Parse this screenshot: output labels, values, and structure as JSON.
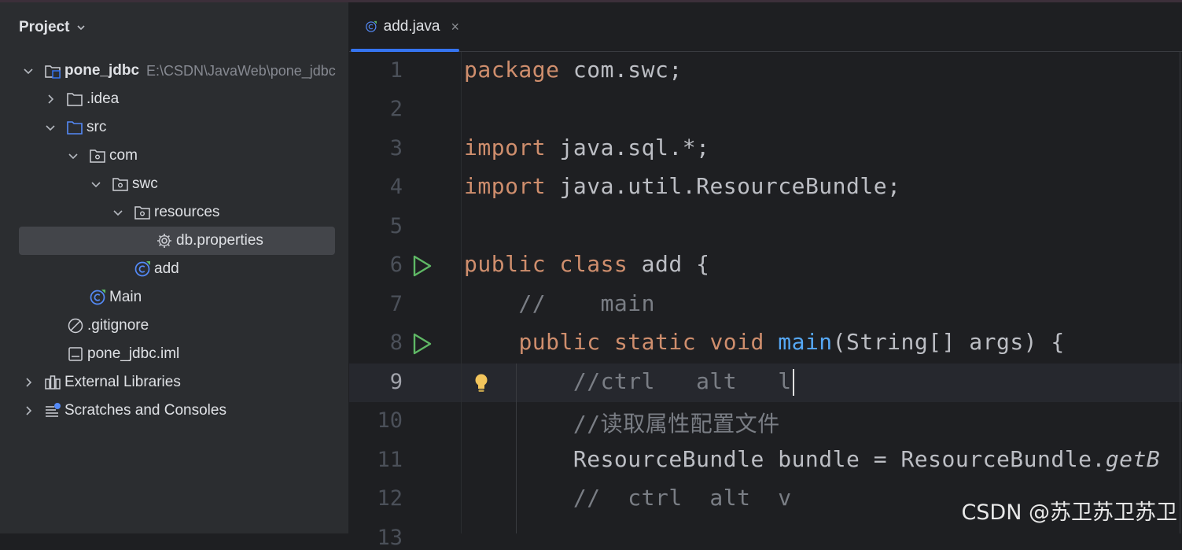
{
  "panel": {
    "title": "Project"
  },
  "tree": {
    "root": {
      "name": "pone_jdbc",
      "path": "E:\\CSDN\\JavaWeb\\pone_jdbc"
    },
    "idea": ".idea",
    "src": "src",
    "com": "com",
    "swc": "swc",
    "resources": "resources",
    "db_properties": "db.properties",
    "add": "add",
    "main": "Main",
    "gitignore": ".gitignore",
    "iml": "pone_jdbc.iml",
    "external_libraries": "External Libraries",
    "scratches": "Scratches and Consoles"
  },
  "editor": {
    "tab": {
      "label": "add.java",
      "close": "×"
    },
    "line_numbers": [
      "1",
      "2",
      "3",
      "4",
      "5",
      "6",
      "7",
      "8",
      "9",
      "10",
      "11",
      "12",
      "13"
    ],
    "current_line": 9,
    "code": {
      "l1_kw": "package",
      "l1_rest": " com.swc;",
      "l3_kw": "import",
      "l3_rest": " java.sql.*;",
      "l4_kw": "import",
      "l4_rest": " java.util.ResourceBundle;",
      "l6_kw": "public class",
      "l6_rest": " add {",
      "l7": "    //    main",
      "l8_indent": "    ",
      "l8_kw": "public static void",
      "l8_sp": " ",
      "l8_fn": "main",
      "l8_rest": "(String[] args) {",
      "l9": "        //ctrl   alt   l",
      "l10": "        //读取属性配置文件",
      "l11_a": "        ResourceBundle bundle = ResourceBundle.",
      "l11_b": "getB",
      "l12": "        //  ctrl  alt  v"
    }
  },
  "watermark": "CSDN @苏卫苏卫苏卫",
  "colors": {
    "keyword": "#cf8e6d",
    "function": "#56a8f5",
    "comment": "#7a7e85",
    "accent": "#3574f0",
    "run": "#5fb865"
  }
}
